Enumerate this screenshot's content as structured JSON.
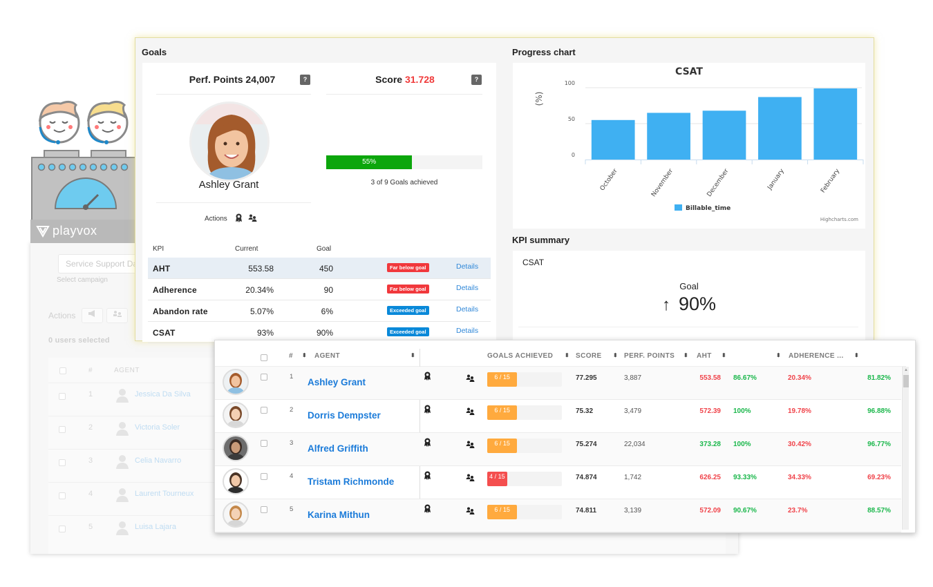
{
  "background_page": {
    "campaign_value": "Service Support Dashboard",
    "campaign_label": "Select campaign",
    "actions_label": "Actions",
    "users_selected": "0 users selected",
    "headers": [
      "#",
      "AGENT"
    ],
    "rows": [
      {
        "num": "1",
        "name": "Jessica Da Silva"
      },
      {
        "num": "2",
        "name": "Victoria Soler"
      },
      {
        "num": "3",
        "name": "Celia Navarro"
      },
      {
        "num": "4",
        "name": "Laurent Tourneux"
      },
      {
        "num": "5",
        "name": "Luisa Lajara"
      }
    ]
  },
  "brand": {
    "logo_text": "playvox"
  },
  "goals": {
    "section_title": "Goals",
    "perf_points_label": "Perf. Points 24,007",
    "score_label": "Score",
    "score_value": "31.728",
    "help_glyph": "?",
    "agent_name": "Ashley Grant",
    "actions_label": "Actions",
    "progress_percent": 55,
    "progress_label": "55%",
    "goals_achieved_text": "3 of 9 Goals achieved",
    "kpi_headers": {
      "kpi": "KPI",
      "current": "Current",
      "goal": "Goal"
    },
    "kpis": [
      {
        "name": "AHT",
        "current": "553.58",
        "goal": "450",
        "status": "Far below goal",
        "status_type": "red",
        "details": "Details"
      },
      {
        "name": "Adherence",
        "current": "20.34%",
        "goal": "90",
        "status": "Far below goal",
        "status_type": "red",
        "details": "Details"
      },
      {
        "name": "Abandon rate",
        "current": "5.07%",
        "goal": "6%",
        "status": "Exceeded goal",
        "status_type": "blue",
        "details": "Details"
      },
      {
        "name": "CSAT",
        "current": "93%",
        "goal": "90%",
        "status": "Exceeded goal",
        "status_type": "blue",
        "details": "Details"
      }
    ]
  },
  "progress_chart": {
    "section_title": "Progress chart",
    "credit": "Highcharts.com"
  },
  "chart_data": {
    "type": "bar",
    "title": "CSAT",
    "xlabel": "",
    "ylabel": "(%)",
    "categories": [
      "October",
      "November",
      "December",
      "January",
      "February"
    ],
    "series": [
      {
        "name": "Billable_time",
        "values": [
          55,
          65,
          68,
          87,
          99
        ],
        "color": "#3fb0f2"
      }
    ],
    "ylim": [
      0,
      100
    ],
    "yticks": [
      0,
      50,
      100
    ],
    "grid": true,
    "legend": "bottom-center"
  },
  "kpi_summary": {
    "section_title": "KPI summary",
    "kpi_name": "CSAT",
    "goal_label": "Goal",
    "goal_arrow": "↑",
    "goal_value": "90%"
  },
  "agents_table": {
    "headers": {
      "num": "#",
      "agent": "AGENT",
      "goals_achieved": "GOALS ACHIEVED",
      "score": "SCORE",
      "perf_points": "PERF. POINTS",
      "aht": "AHT",
      "adherence": "ADHERENCE ..."
    },
    "sort_glyph": "⬍",
    "rows": [
      {
        "num": "1",
        "name": "Ashley Grant",
        "goals_done": 6,
        "goals_total": 15,
        "goals_text": "6 / 15",
        "goals_color": "#ffaa3e",
        "score": "77.295",
        "perf_points": "3,887",
        "aht": "553.58",
        "aht_status": "red",
        "aht_pct": "86.67%",
        "aht_pct_status": "green",
        "adherence": "20.34%",
        "adh_status": "red",
        "adh_pct": "81.82%",
        "adh_pct_status": "green"
      },
      {
        "num": "2",
        "name": "Dorris Dempster",
        "goals_done": 6,
        "goals_total": 15,
        "goals_text": "6 / 15",
        "goals_color": "#ffaa3e",
        "score": "75.32",
        "perf_points": "3,479",
        "aht": "572.39",
        "aht_status": "red",
        "aht_pct": "100%",
        "aht_pct_status": "green",
        "adherence": "19.78%",
        "adh_status": "red",
        "adh_pct": "96.88%",
        "adh_pct_status": "green"
      },
      {
        "num": "3",
        "name": "Alfred Griffith",
        "goals_done": 6,
        "goals_total": 15,
        "goals_text": "6 / 15",
        "goals_color": "#ffaa3e",
        "score": "75.274",
        "perf_points": "22,034",
        "aht": "373.28",
        "aht_status": "green",
        "aht_pct": "100%",
        "aht_pct_status": "green",
        "adherence": "30.42%",
        "adh_status": "red",
        "adh_pct": "96.77%",
        "adh_pct_status": "green"
      },
      {
        "num": "4",
        "name": "Tristam Richmonde",
        "goals_done": 4,
        "goals_total": 15,
        "goals_text": "4 / 15",
        "goals_color": "#f44e4e",
        "score": "74.874",
        "perf_points": "1,742",
        "aht": "626.25",
        "aht_status": "red",
        "aht_pct": "93.33%",
        "aht_pct_status": "green",
        "adherence": "34.33%",
        "adh_status": "red",
        "adh_pct": "69.23%",
        "adh_pct_status": "red"
      },
      {
        "num": "5",
        "name": "Karina Mithun",
        "goals_done": 6,
        "goals_total": 15,
        "goals_text": "6 / 15",
        "goals_color": "#ffaa3e",
        "score": "74.811",
        "perf_points": "3,139",
        "aht": "572.09",
        "aht_status": "red",
        "aht_pct": "90.67%",
        "aht_pct_status": "green",
        "adherence": "23.7%",
        "adh_status": "red",
        "adh_pct": "88.57%",
        "adh_pct_status": "green"
      }
    ]
  }
}
